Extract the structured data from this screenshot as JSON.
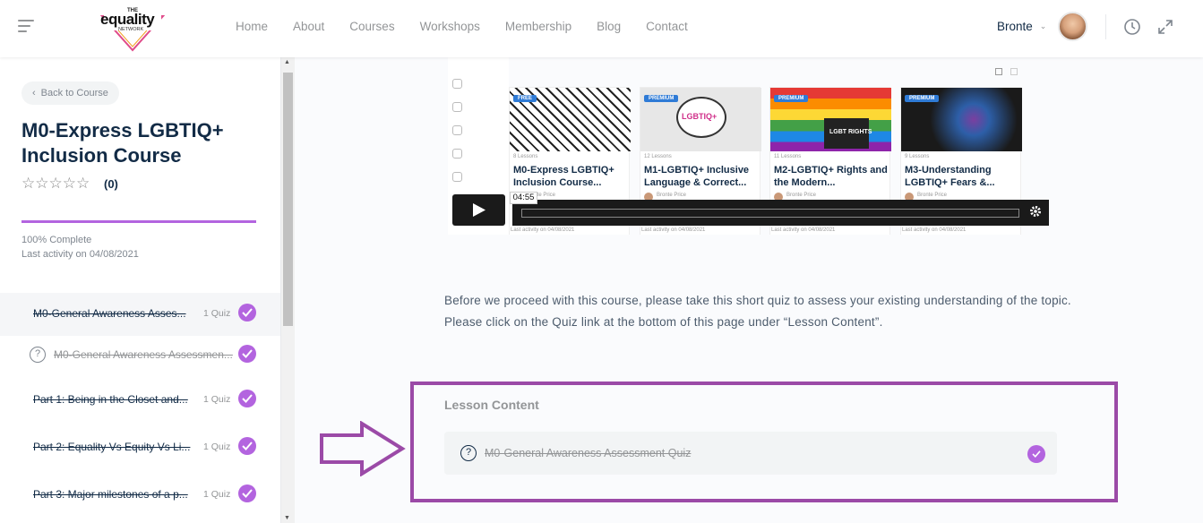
{
  "header": {
    "logo": {
      "small": "THE",
      "big": "equality",
      "sub": "NETWORK"
    },
    "nav": [
      "Home",
      "About",
      "Courses",
      "Workshops",
      "Membership",
      "Blog",
      "Contact"
    ],
    "user_name": "Bronte",
    "icons": [
      "menu-icon",
      "chevron-down-icon",
      "dark-mode-icon",
      "expand-icon"
    ]
  },
  "sidebar": {
    "back_label": "Back to Course",
    "course_title": "M0-Express LGBTIQ+ Inclusion Course",
    "stars": "☆☆☆☆☆",
    "rating_count": "(0)",
    "progress_percent": 100,
    "complete_text": "100% Complete",
    "last_activity": "Last activity on 04/08/2021",
    "lessons": [
      {
        "title": "M0-General Awareness Asses...",
        "meta": "1 Quiz",
        "type": "lesson"
      },
      {
        "title": "M0-General Awareness Assessmen...",
        "meta": "",
        "type": "quiz"
      },
      {
        "title": "Part 1: Being in the Closet and...",
        "meta": "1 Quiz",
        "type": "lesson"
      },
      {
        "title": "Part 2: Equality Vs Equity Vs Li...",
        "meta": "1 Quiz",
        "type": "lesson"
      },
      {
        "title": "Part 3: Major milestones of a p...",
        "meta": "1 Quiz",
        "type": "lesson"
      }
    ]
  },
  "video": {
    "time": "04:55",
    "cards": [
      {
        "badge": "FREE",
        "lessons": "8 Lessons",
        "title": "M0-Express LGBTIQ+ Inclusion Course...",
        "author": "Bronte Price",
        "activity": "Last activity on 04/08/2021"
      },
      {
        "badge": "PREMIUM",
        "lessons": "12 Lessons",
        "title": "M1-LGBTIQ+ Inclusive Language & Correct...",
        "author": "Bronte Price",
        "activity": "Last activity on 04/08/2021"
      },
      {
        "badge": "PREMIUM",
        "lessons": "11 Lessons",
        "title": "M2-LGBTIQ+ Rights and the Modern...",
        "author": "Bronte Price",
        "activity": "Last activity on 04/08/2021"
      },
      {
        "badge": "PREMIUM",
        "lessons": "9 Lessons",
        "title": "M3-Understanding LGBTIQ+ Fears &...",
        "author": "Bronte Price",
        "activity": "Last activity on 04/08/2021"
      }
    ],
    "card_image_texts": [
      "LGBTIQ+",
      "LGBT RIGHTS"
    ]
  },
  "content": {
    "description": "Before we proceed with this course, please take this short quiz to assess your existing understanding of the topic. Please click on the Quiz link at the bottom of this page under “Lesson Content”.",
    "lesson_content_title": "Lesson Content",
    "quiz_item": "M0-General Awareness Assessment Quiz"
  },
  "colors": {
    "accent": "#b364df",
    "highlight_border": "#9b4aa7",
    "text_dark": "#122b46"
  }
}
